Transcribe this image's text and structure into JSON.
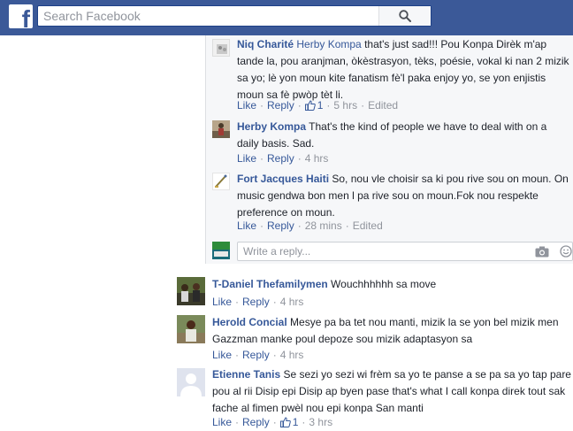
{
  "search": {
    "placeholder": "Search Facebook"
  },
  "replies": [
    {
      "author": "Niq Charité",
      "mention": "Herby Kompa",
      "text_lines": [
        "that's just sad!!! Pou Konpa Dirèk m'ap",
        "tande la, pou aranjman, òkèstrasyon, tèks, poésie, vokal ki nan 2 mizik",
        "sa yo; lè yon moun kite fanatism fè'l paka enjoy yo, se yon enjistis",
        "moun sa fè pwòp tèt li."
      ],
      "like_label": "Like",
      "reply_label": "Reply",
      "likes": "1",
      "time": "5 hrs",
      "edited": "Edited"
    },
    {
      "author": "Herby Kompa",
      "text_lines": [
        "That's the kind of people we have to deal with on a",
        "daily basis. Sad."
      ],
      "like_label": "Like",
      "reply_label": "Reply",
      "time": "4 hrs"
    },
    {
      "author": "Fort Jacques Haiti",
      "text_lines": [
        "So, nou vle choisir sa ki pou rive sou on moun. On",
        "music gendwa bon men l pa rive sou on moun.Fok nou respekte",
        "preference on moun."
      ],
      "like_label": "Like",
      "reply_label": "Reply",
      "time": "28 mins",
      "edited": "Edited"
    }
  ],
  "reply_input": {
    "placeholder": "Write a reply..."
  },
  "comments": [
    {
      "author": "T-Daniel Thefamilymen",
      "text_lines": [
        "Wouchhhhhh sa move"
      ],
      "like_label": "Like",
      "reply_label": "Reply",
      "time": "4 hrs"
    },
    {
      "author": "Herold Concial",
      "text_lines": [
        "Mesye pa ba tet nou manti, mizik la se yon bel mizik men",
        "Gazzman manke poul depoze sou mizik adaptasyon sa"
      ],
      "like_label": "Like",
      "reply_label": "Reply",
      "time": "4 hrs"
    },
    {
      "author": "Etienne Tanis",
      "text_lines": [
        "Se sezi yo sezi wi frèm sa yo te panse a se pa sa yo tap pare",
        "pou al rii Disip epi Disip ap byen pase that's what I call konpa direk tout sak",
        "fache al fimen pwèl nou epi konpa San manti"
      ],
      "like_label": "Like",
      "reply_label": "Reply",
      "likes": "1",
      "time": "3 hrs"
    }
  ],
  "colors": {
    "header": "#3b5998",
    "link": "#365899",
    "meta": "#90949c",
    "reply_bg": "#f6f7f9"
  },
  "icons": [
    "facebook-logo-icon",
    "search-icon",
    "thumbs-up-icon",
    "camera-icon",
    "smiley-icon"
  ]
}
